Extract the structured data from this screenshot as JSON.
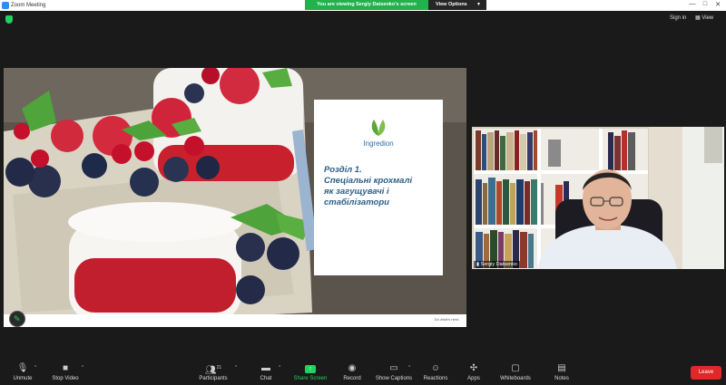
{
  "window": {
    "title": "Zoom Meeting",
    "share_banner": "You are viewing Sergiy Datsenko's screen",
    "view_options": "View Options",
    "controls": [
      "—",
      "□",
      "✕"
    ]
  },
  "top": {
    "sign_in": "Sign in",
    "view": "View"
  },
  "slide": {
    "logo_text": "Ingredion",
    "title_lines": [
      "Розділ 1.",
      "Спеціальні крохмалі",
      "як загущувачі і",
      "стабілізатори"
    ],
    "footer_tag": "Do what's next."
  },
  "video": {
    "participant_name": "Sergiy Datsenko"
  },
  "toolbar": {
    "unmute": "Unmute",
    "stop_video": "Stop Video",
    "participants": "Participants",
    "participants_count": "21",
    "chat": "Chat",
    "share_screen": "Share Screen",
    "record": "Record",
    "show_captions": "Show Captions",
    "reactions": "Reactions",
    "apps": "Apps",
    "whiteboards": "Whiteboards",
    "notes": "Notes",
    "leave": "Leave"
  },
  "colors": {
    "accent_green": "#23d160",
    "leave_red": "#e02828",
    "zoom_blue": "#2d8cff"
  }
}
